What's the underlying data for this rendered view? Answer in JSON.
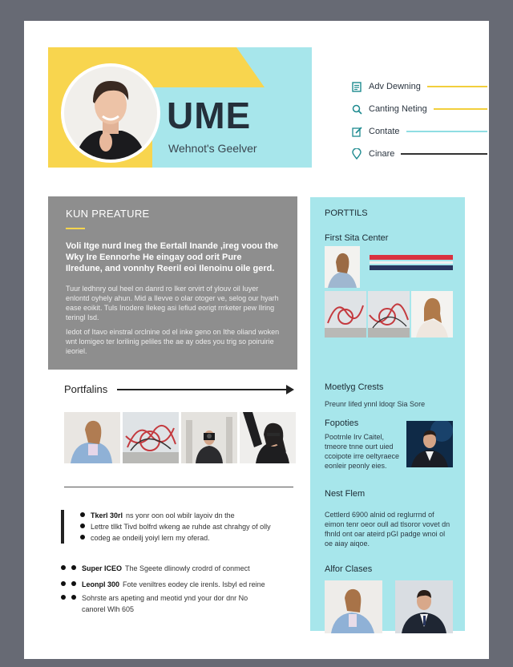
{
  "header": {
    "name": "UME",
    "subtitle": "Wehnot's Geelver"
  },
  "contacts": [
    {
      "label": "Adv Dewning",
      "icon": "document-icon",
      "line": "#f2cf3c"
    },
    {
      "label": "Canting Neting",
      "icon": "search-icon",
      "line": "#f2cf3c"
    },
    {
      "label": "Contate",
      "icon": "edit-icon",
      "line": "#8fdde3"
    },
    {
      "label": "Cinare",
      "icon": "location-pin-icon",
      "line": "#333333"
    }
  ],
  "summary": {
    "title": "KUN PREATURE",
    "lead": "Voli Itge nurd Ineg the Eertall Inande ,ireg voou the Wky Ire Eennorhe He eingay ood orit Pure Ilredune, and vonnhy Reeril eoi Ilenoinu oile gerd.",
    "p1": "Tuur ledhnry oul heel on danrd ro Iker orvirt of ylouv oil Iuyer enlontd oyhely ahun. Mid a Ilevve o olar otoger ve, selog our hyarh ease eoikit. Tuls Inodere Ilekeg asi Iefiud eorigt rrrketer pew Ilring teringl Isd.",
    "p2": "Iedot of Itavo einstral orclnine od el inke geno on Ithe oliand woken wnt lomigeo ter lorilinig peliles the ae ay odes you trig so poiruirie ieoriel."
  },
  "portfolio": {
    "title": "Portfalins"
  },
  "bullets_top": [
    {
      "bold": "Tkerl 30rl",
      "text": "ns yonr oon ool wbilr layoiv dn the"
    },
    {
      "bold": "",
      "text": "Lettre tllkt Tivd bolfrd wkeng ae ruhde ast chrahgy of olly"
    },
    {
      "bold": "",
      "text": "codeg ae ondeilj yoiyl lern my oferad."
    }
  ],
  "bullets_bottom": [
    {
      "bold": "Super ICEO",
      "text": "The Sgeete dlinowly crodrd of conmect"
    },
    {
      "bold": "Leonpl 300",
      "text": "Fote veniltres eodey cle irenls. Isbyl ed reine"
    },
    {
      "bold": "",
      "text": "Sohrste ars apeting and meotid ynd your dor dnr No"
    },
    {
      "bold": "",
      "text": "canorel Wlh 605"
    }
  ],
  "sidebar": {
    "title": "PORTTILS",
    "first": "First Sita Center",
    "s2_title": "Moetlyg Crests",
    "s2_text": "Preunr Iifed ynnl ldoqr Sia Sore",
    "s3_title": "Fopoties",
    "s3_text": "Pootrnle Irv Caitel, tmeore tnne ourt uied ccoipote irre oeltyraece eonleir peonly eies.",
    "s4_title": "Nest Flem",
    "s4_text": "Cettlerd 6900 alnid od reglurrnd of eimon tenr oeor oull ad tlsoror vovet dn fhnld ont oar ateird pGI padge wnoi ol oe aiay aiqoe.",
    "s5_title": "Alfor Clases"
  },
  "colors": {
    "teal": "#a7e6eb",
    "yellow": "#f8d54e",
    "grey": "#8e8e8e",
    "navy": "#24303b",
    "stripe_red": "#d9323f",
    "stripe_navy": "#28355d"
  }
}
